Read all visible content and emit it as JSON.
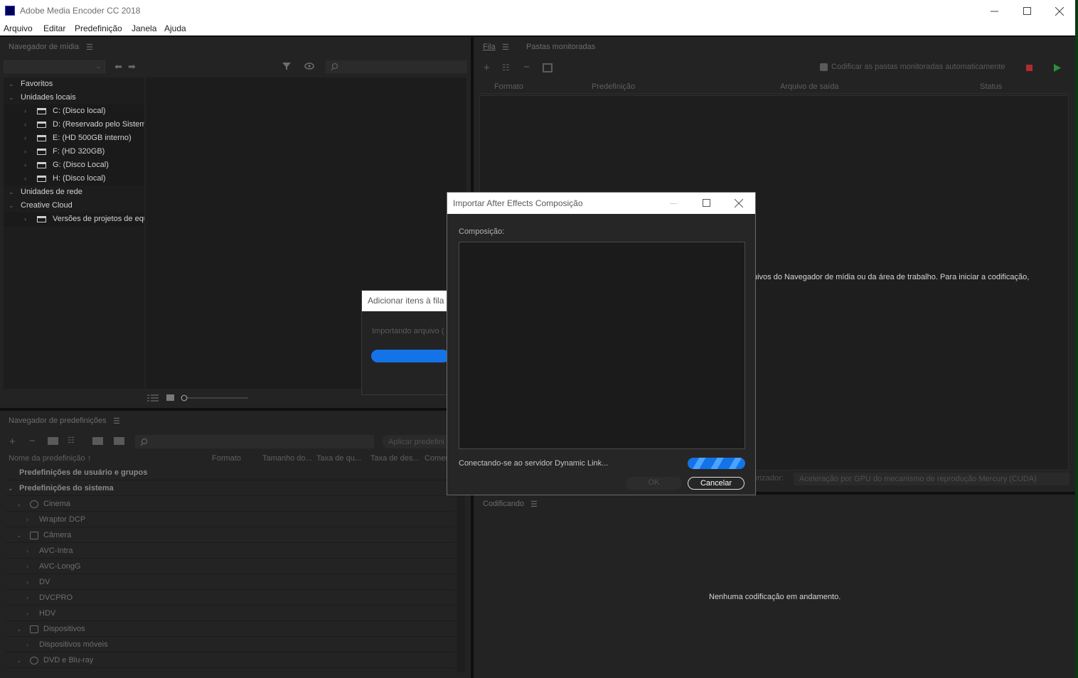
{
  "window": {
    "title": "Adobe Media Encoder CC 2018"
  },
  "menu": [
    "Arquivo",
    "Editar",
    "Predefinição",
    "Janela",
    "Ajuda"
  ],
  "media_browser": {
    "title": "Navegador de mídia",
    "tree": [
      {
        "label": "Favoritos",
        "level": 0
      },
      {
        "label": "Unidades locais",
        "level": 0
      },
      {
        "label": "C: (Disco local)",
        "level": 1
      },
      {
        "label": "D: (Reservado pelo Sistema",
        "level": 1
      },
      {
        "label": "E: (HD 500GB interno)",
        "level": 1
      },
      {
        "label": "F: (HD 320GB)",
        "level": 1
      },
      {
        "label": "G: (Disco Local)",
        "level": 1
      },
      {
        "label": "H: (Disco local)",
        "level": 1
      },
      {
        "label": "Unidades de rede",
        "level": 0
      },
      {
        "label": "Creative Cloud",
        "level": 0
      },
      {
        "label": "Versões de projetos de equ",
        "level": 1
      }
    ]
  },
  "preset_browser": {
    "title": "Navegador de predefinições",
    "apply_label": "Aplicar predefini",
    "columns": [
      "Nome da predefinição",
      "Formato",
      "Tamanho do...",
      "Taxa de qu...",
      "Taxa de des...",
      "Comen"
    ],
    "rows": [
      {
        "label": "Predefinições de usuário e grupos",
        "kind": "group"
      },
      {
        "label": "Predefinições do sistema",
        "kind": "group"
      },
      {
        "label": "Cinema",
        "kind": "category",
        "icon": "film-reel-icon"
      },
      {
        "label": "Wraptor DCP",
        "kind": "item"
      },
      {
        "label": "Câmera",
        "kind": "category",
        "icon": "camera-icon"
      },
      {
        "label": "AVC-Intra",
        "kind": "item"
      },
      {
        "label": "AVC-LongG",
        "kind": "item"
      },
      {
        "label": "DV",
        "kind": "item"
      },
      {
        "label": "DVCPRO",
        "kind": "item"
      },
      {
        "label": "HDV",
        "kind": "item"
      },
      {
        "label": "Dispositivos",
        "kind": "category",
        "icon": "phone-icon"
      },
      {
        "label": "Dispositivos móveis",
        "kind": "item"
      },
      {
        "label": "DVD e Blu-ray",
        "kind": "category",
        "icon": "disc-icon"
      }
    ]
  },
  "queue": {
    "tab_queue": "Fila",
    "tab_watch": "Pastas monitoradas",
    "auto_encode_label": "Codificar as pastas monitoradas automaticamente",
    "columns": [
      "Formato",
      "Predefinição",
      "Arquivo de saída",
      "Status"
    ],
    "hint_text": "uivos do Navegador de mídia ou da área de trabalho.  Para iniciar a codificação,",
    "renderer_label": "erizador:",
    "renderer_value": "Aceleração por GPU do mecanismo de reprodução Mercury (CUDA)"
  },
  "encoding": {
    "title": "Codificando",
    "empty_text": "Nenhuma codificação em andamento."
  },
  "add_items_dialog": {
    "title": "Adicionar itens à fila",
    "status": "Importando arquivo ("
  },
  "import_dialog": {
    "title": "Importar After Effects Composição",
    "composition_label": "Composição:",
    "status": "Conectando-se ao servidor Dynamic Link...",
    "ok_label": "OK",
    "cancel_label": "Cancelar"
  },
  "colors": {
    "accent": "#1473e6",
    "stop": "#c42f2f",
    "play": "#2d9d3a"
  }
}
